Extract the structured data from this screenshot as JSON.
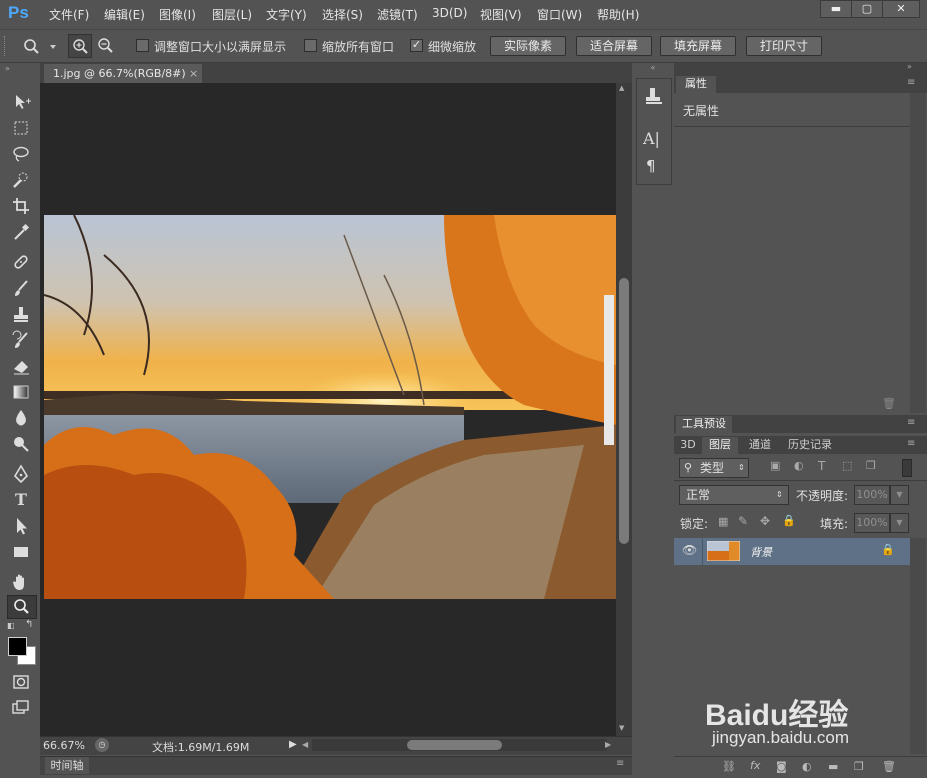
{
  "app": {
    "logo": "Ps"
  },
  "menu": [
    "文件(F)",
    "编辑(E)",
    "图像(I)",
    "图层(L)",
    "文字(Y)",
    "选择(S)",
    "滤镜(T)",
    "3D(D)",
    "视图(V)",
    "窗口(W)",
    "帮助(H)"
  ],
  "window_controls": {
    "minimize": "▬",
    "maximize": "▢",
    "close": "✕"
  },
  "options_bar": {
    "resize_windows_label": "调整窗口大小以满屏显示",
    "resize_windows_checked": false,
    "zoom_all_label": "缩放所有窗口",
    "zoom_all_checked": false,
    "scrubby_zoom_label": "细微缩放",
    "scrubby_zoom_checked": true,
    "actual_pixels": "实际像素",
    "fit_screen": "适合屏幕",
    "fill_screen": "填充屏幕",
    "print_size": "打印尺寸"
  },
  "document": {
    "tab_title": "1.jpg @ 66.7%(RGB/8#)",
    "tab_close": "×",
    "zoom": "66.67%",
    "doc_info": "文档:1.69M/1.69M",
    "timeline": "时间轴"
  },
  "tools": [
    "move-icon",
    "marquee-icon",
    "lasso-icon",
    "quick-select-icon",
    "crop-icon",
    "eyedropper-icon",
    "healing-icon",
    "brush-icon",
    "stamp-icon",
    "history-brush-icon",
    "eraser-icon",
    "gradient-icon",
    "blur-icon",
    "dodge-icon",
    "pen-icon",
    "type-icon",
    "path-select-icon",
    "shape-icon",
    "hand-icon",
    "zoom-icon"
  ],
  "colors": {
    "foreground": "#000000",
    "background": "#ffffff",
    "accent": "#4da9ff",
    "selected_layer": "#5f7186"
  },
  "properties_panel": {
    "tab": "属性",
    "content": "无属性"
  },
  "tool_presets": {
    "tab": "工具预设"
  },
  "layers_panel": {
    "tabs": [
      "3D",
      "图层",
      "通道",
      "历史记录"
    ],
    "active_tab": "图层",
    "filter_kind": "类型",
    "blend_mode": "正常",
    "opacity_label": "不透明度:",
    "opacity_value": "100%",
    "lock_label": "锁定:",
    "fill_label": "填充:",
    "fill_value": "100%",
    "layers": [
      {
        "name": "背景",
        "visible": true,
        "locked": true
      }
    ]
  },
  "watermark": {
    "brand": "Baidu经验",
    "url": "jingyan.baidu.com"
  }
}
